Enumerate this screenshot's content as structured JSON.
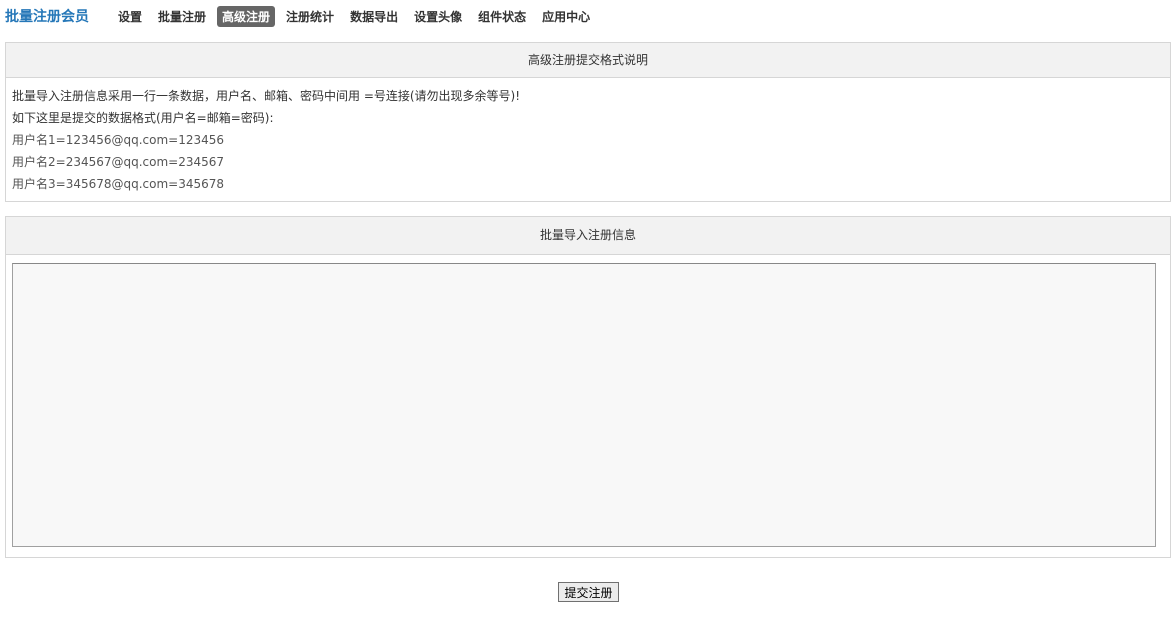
{
  "header": {
    "brand": "批量注册会员",
    "nav": [
      {
        "label": "设置",
        "active": false
      },
      {
        "label": "批量注册",
        "active": false
      },
      {
        "label": "高级注册",
        "active": true
      },
      {
        "label": "注册统计",
        "active": false
      },
      {
        "label": "数据导出",
        "active": false
      },
      {
        "label": "设置头像",
        "active": false
      },
      {
        "label": "组件状态",
        "active": false
      },
      {
        "label": "应用中心",
        "active": false
      }
    ]
  },
  "format_panel": {
    "title": "高级注册提交格式说明",
    "lines": [
      "批量导入注册信息采用一行一条数据，用户名、邮箱、密码中间用 =号连接(请勿出现多余等号)!",
      "如下这里是提交的数据格式(用户名=邮箱=密码):",
      "用户名1=123456@qq.com=123456",
      "用户名2=234567@qq.com=234567",
      "用户名3=345678@qq.com=345678"
    ]
  },
  "import_panel": {
    "title": "批量导入注册信息",
    "textarea_value": ""
  },
  "submit_label": "提交注册"
}
